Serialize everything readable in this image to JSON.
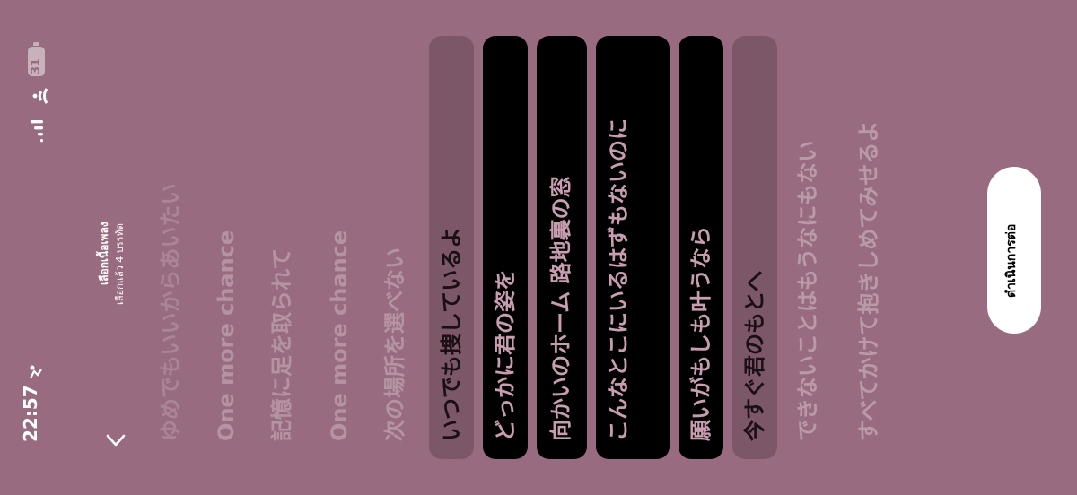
{
  "status_bar": {
    "time": "22:57",
    "time_icon": "person-activity-icon",
    "signal_icon": "cellular-signal-icon",
    "wifi_icon": "wifi-icon",
    "battery_level": "31"
  },
  "header": {
    "back_icon": "chevron-back-icon",
    "title": "เลือกเนื้อเพลง",
    "subtitle": "เลือกแล้ว 4 บรรทัด"
  },
  "lyrics": [
    {
      "text": "ゆめでもいいからあいたい",
      "state": "faded"
    },
    {
      "text": "One more chance",
      "state": "faded"
    },
    {
      "text": "記憶に足を取られて",
      "state": "faded"
    },
    {
      "text": "One more chance",
      "state": "faded"
    },
    {
      "text": "次の場所を選べない",
      "state": "faded"
    },
    {
      "text": "いつでも捜しているよ",
      "state": "unselected"
    },
    {
      "text": "どっかに君の姿を",
      "state": "selected"
    },
    {
      "text": "向かいのホーム 路地裏の窓",
      "state": "selected"
    },
    {
      "text": "こんなとこにいるはずもないのに",
      "state": "selected"
    },
    {
      "text": "願いがもしも叶うなら",
      "state": "selected"
    },
    {
      "text": "今すぐ君のもとへ",
      "state": "unselected"
    },
    {
      "text": "できないことはもうなにもない",
      "state": "faded"
    },
    {
      "text": "すべてかけて抱きしめてみせるよ",
      "state": "faded"
    }
  ],
  "actions": {
    "continue_label": "ดำเนินการต่อ"
  },
  "colors": {
    "background": "#986b80",
    "selected_card": "#000000",
    "unselected_card": "#7c5768",
    "selected_text": "#c89db1"
  }
}
